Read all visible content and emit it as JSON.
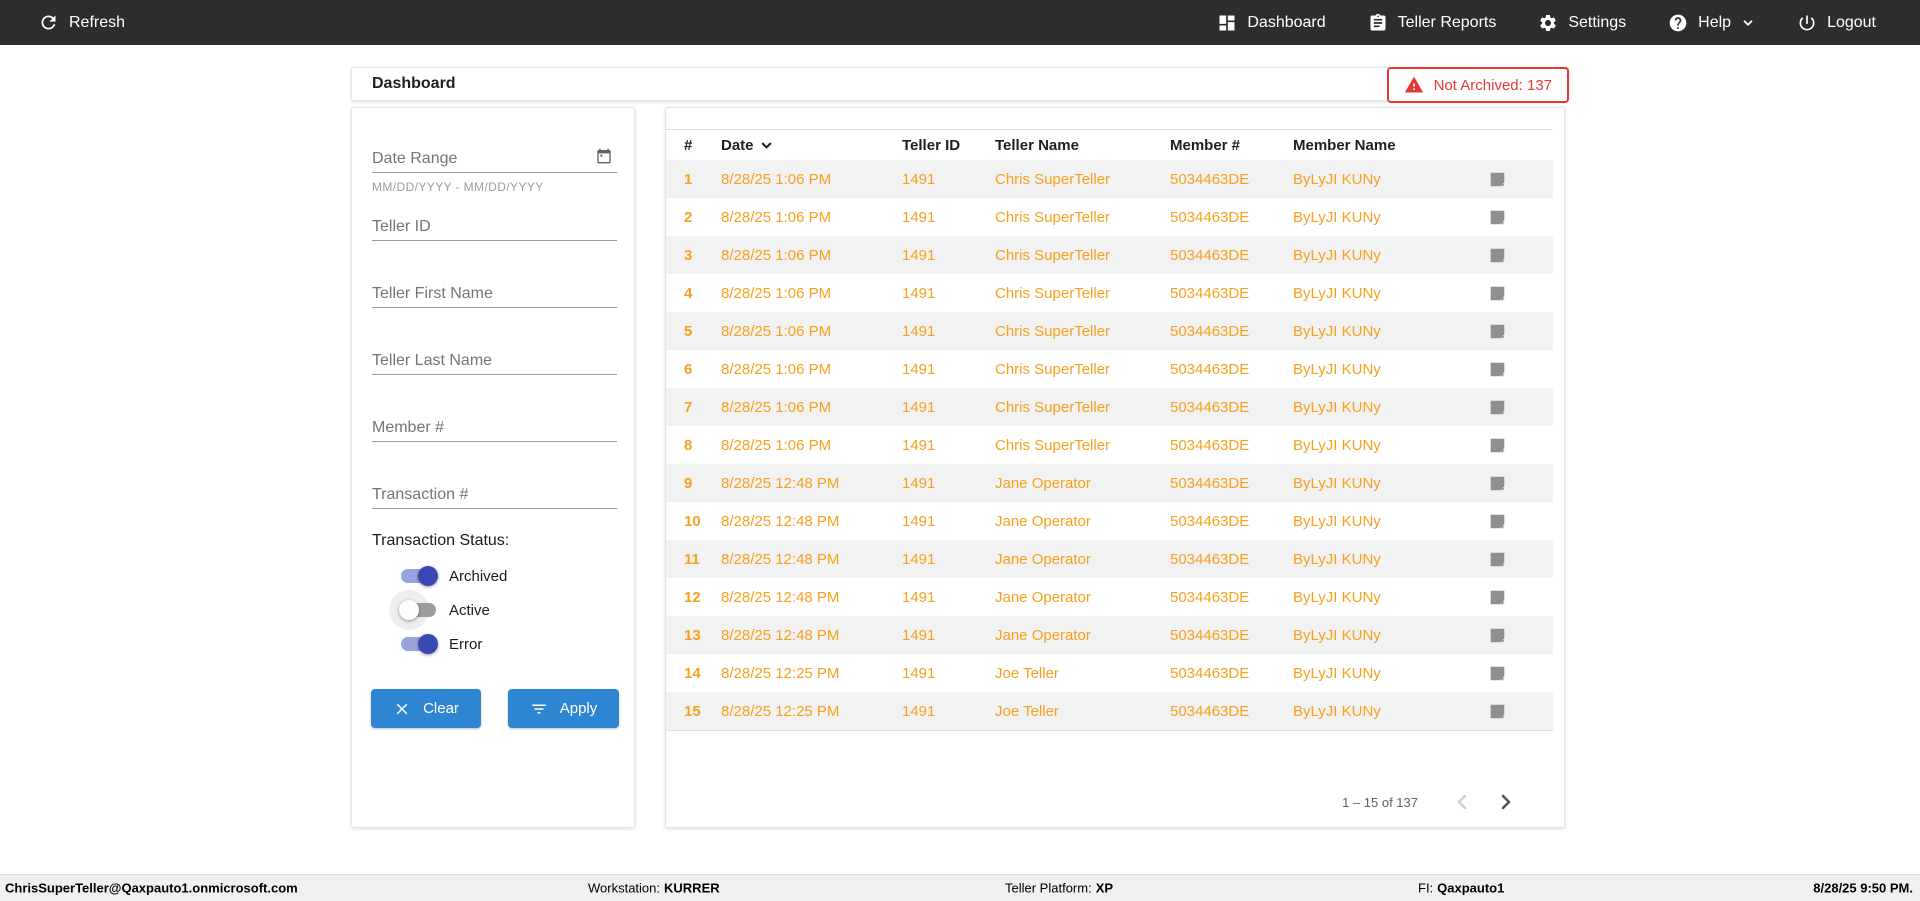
{
  "navbar": {
    "refresh_label": "Refresh",
    "refresh_icon": "refresh-icon",
    "items": [
      {
        "label": "Dashboard",
        "icon": "dashboard-icon"
      },
      {
        "label": "Teller Reports",
        "icon": "clipboard-icon"
      },
      {
        "label": "Settings",
        "icon": "gear-icon"
      },
      {
        "label": "Help",
        "icon": "help-icon",
        "has_dropdown": true
      },
      {
        "label": "Logout",
        "icon": "power-icon"
      }
    ]
  },
  "header": {
    "title": "Dashboard",
    "alert_badge": {
      "label": "Not Archived: 137",
      "icon": "warning-icon",
      "color": "#e53935"
    }
  },
  "filters": {
    "date_range_label": "Date Range",
    "date_range_icon": "calendar-icon",
    "date_range_hint": "MM/DD/YYYY - MM/DD/YYYY",
    "teller_id_label": "Teller ID",
    "teller_first_name_label": "Teller First Name",
    "teller_last_name_label": "Teller Last Name",
    "member_number_label": "Member #",
    "transaction_number_label": "Transaction #",
    "status_label": "Transaction Status:",
    "status_toggles": [
      {
        "label": "Archived",
        "on": true
      },
      {
        "label": "Active",
        "on": false
      },
      {
        "label": "Error",
        "on": true
      }
    ],
    "clear_label": "Clear",
    "clear_icon": "close-icon",
    "apply_label": "Apply",
    "apply_icon": "filter-icon"
  },
  "table": {
    "columns": [
      "#",
      "Date",
      "Teller ID",
      "Teller Name",
      "Member #",
      "Member Name"
    ],
    "sorted_column": "Date",
    "sort_direction": "desc",
    "sort_icon": "chevron-down-icon",
    "row_icon": "note-icon",
    "rows": [
      {
        "num": "1",
        "date": "8/28/25 1:06 PM",
        "teller_id": "1491",
        "teller_name": "Chris SuperTeller",
        "member_number": "5034463DE",
        "member_name": "ByLyJI KUNy"
      },
      {
        "num": "2",
        "date": "8/28/25 1:06 PM",
        "teller_id": "1491",
        "teller_name": "Chris SuperTeller",
        "member_number": "5034463DE",
        "member_name": "ByLyJI KUNy"
      },
      {
        "num": "3",
        "date": "8/28/25 1:06 PM",
        "teller_id": "1491",
        "teller_name": "Chris SuperTeller",
        "member_number": "5034463DE",
        "member_name": "ByLyJI KUNy"
      },
      {
        "num": "4",
        "date": "8/28/25 1:06 PM",
        "teller_id": "1491",
        "teller_name": "Chris SuperTeller",
        "member_number": "5034463DE",
        "member_name": "ByLyJI KUNy"
      },
      {
        "num": "5",
        "date": "8/28/25 1:06 PM",
        "teller_id": "1491",
        "teller_name": "Chris SuperTeller",
        "member_number": "5034463DE",
        "member_name": "ByLyJI KUNy"
      },
      {
        "num": "6",
        "date": "8/28/25 1:06 PM",
        "teller_id": "1491",
        "teller_name": "Chris SuperTeller",
        "member_number": "5034463DE",
        "member_name": "ByLyJI KUNy"
      },
      {
        "num": "7",
        "date": "8/28/25 1:06 PM",
        "teller_id": "1491",
        "teller_name": "Chris SuperTeller",
        "member_number": "5034463DE",
        "member_name": "ByLyJI KUNy"
      },
      {
        "num": "8",
        "date": "8/28/25 1:06 PM",
        "teller_id": "1491",
        "teller_name": "Chris SuperTeller",
        "member_number": "5034463DE",
        "member_name": "ByLyJI KUNy"
      },
      {
        "num": "9",
        "date": "8/28/25 12:48 PM",
        "teller_id": "1491",
        "teller_name": "Jane Operator",
        "member_number": "5034463DE",
        "member_name": "ByLyJI KUNy"
      },
      {
        "num": "10",
        "date": "8/28/25 12:48 PM",
        "teller_id": "1491",
        "teller_name": "Jane Operator",
        "member_number": "5034463DE",
        "member_name": "ByLyJI KUNy"
      },
      {
        "num": "11",
        "date": "8/28/25 12:48 PM",
        "teller_id": "1491",
        "teller_name": "Jane Operator",
        "member_number": "5034463DE",
        "member_name": "ByLyJI KUNy"
      },
      {
        "num": "12",
        "date": "8/28/25 12:48 PM",
        "teller_id": "1491",
        "teller_name": "Jane Operator",
        "member_number": "5034463DE",
        "member_name": "ByLyJI KUNy"
      },
      {
        "num": "13",
        "date": "8/28/25 12:48 PM",
        "teller_id": "1491",
        "teller_name": "Jane Operator",
        "member_number": "5034463DE",
        "member_name": "ByLyJI KUNy"
      },
      {
        "num": "14",
        "date": "8/28/25 12:25 PM",
        "teller_id": "1491",
        "teller_name": "Joe Teller",
        "member_number": "5034463DE",
        "member_name": "ByLyJI KUNy"
      },
      {
        "num": "15",
        "date": "8/28/25 12:25 PM",
        "teller_id": "1491",
        "teller_name": "Joe Teller",
        "member_number": "5034463DE",
        "member_name": "ByLyJI KUNy"
      }
    ],
    "pagination": {
      "range_label": "1 – 15 of 137",
      "prev_enabled": false,
      "next_enabled": true,
      "prev_icon": "chevron-left-icon",
      "next_icon": "chevron-right-icon"
    }
  },
  "footer": {
    "user_email": "ChrisSuperTeller@Qaxpauto1.onmicrosoft.com",
    "workstation_label": "Workstation:",
    "workstation_value": "KURRER",
    "platform_label": "Teller Platform:",
    "platform_value": "XP",
    "fi_label": "FI:",
    "fi_value": "Qaxpauto1",
    "datetime": "8/28/25 9:50 PM."
  },
  "colors": {
    "navbar_bg": "#2d2d2d",
    "accent_blue": "#2e86d3",
    "row_text_orange": "#f7a01d",
    "alert_red": "#e53935",
    "toggle_on_indigo": "#3a49b1",
    "odd_row_bg": "#f2f2f2"
  }
}
